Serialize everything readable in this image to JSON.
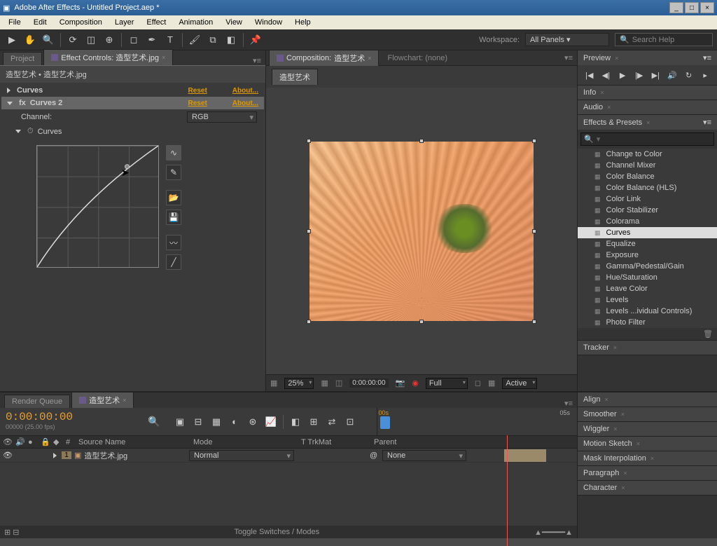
{
  "window": {
    "title": "Adobe After Effects - Untitled Project.aep *"
  },
  "menu": [
    "File",
    "Edit",
    "Composition",
    "Layer",
    "Effect",
    "Animation",
    "View",
    "Window",
    "Help"
  ],
  "workspace": {
    "label": "Workspace:",
    "value": "All Panels",
    "search_placeholder": "Search Help"
  },
  "project_tabs": {
    "project": "Project",
    "fx": "Effect Controls: 造型艺术.jpg"
  },
  "fx_header": "造型艺术 • 造型艺术.jpg",
  "fx": {
    "curves1": {
      "name": "Curves",
      "reset": "Reset",
      "about": "About..."
    },
    "curves2": {
      "name": "Curves 2",
      "reset": "Reset",
      "about": "About..."
    },
    "channel_label": "Channel:",
    "channel_value": "RGB",
    "curves_label": "Curves"
  },
  "comp": {
    "tab_prefix": "Composition:",
    "name": "造型艺术",
    "flowchart": "Flowchart: (none)",
    "subtab": "造型艺术"
  },
  "comp_footer": {
    "zoom": "25%",
    "time": "0:00:00:00",
    "res": "Full",
    "active": "Active"
  },
  "right": {
    "preview": "Preview",
    "info": "Info",
    "audio": "Audio",
    "ep": "Effects & Presets",
    "effects": [
      "Change to Color",
      "Channel Mixer",
      "Color Balance",
      "Color Balance (HLS)",
      "Color Link",
      "Color Stabilizer",
      "Colorama",
      "Curves",
      "Equalize",
      "Exposure",
      "Gamma/Pedestal/Gain",
      "Hue/Saturation",
      "Leave Color",
      "Levels",
      "Levels ...ividual Controls)",
      "Photo Filter"
    ],
    "tracker": "Tracker",
    "align": "Align",
    "smoother": "Smoother",
    "wiggler": "Wiggler",
    "motion": "Motion Sketch",
    "maskint": "Mask Interpolation",
    "paragraph": "Paragraph",
    "character": "Character"
  },
  "timeline": {
    "tab_rq": "Render Queue",
    "tab_comp": "造型艺术",
    "timecode": "0:00:00:00",
    "fps": "00000 (25.00 fps)",
    "cols": {
      "source": "Source Name",
      "mode": "Mode",
      "trk": "T  TrkMat",
      "parent": "Parent"
    },
    "layer": {
      "num": "1",
      "name": "造型艺术.jpg",
      "mode": "Normal",
      "trk": "",
      "parent": "None"
    },
    "ruler_marks": [
      "00s",
      "05s"
    ],
    "footer": "Toggle Switches / Modes"
  }
}
